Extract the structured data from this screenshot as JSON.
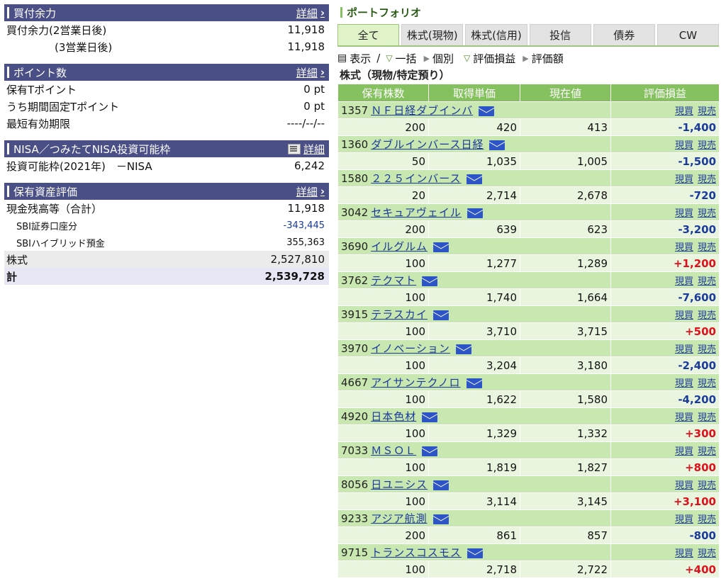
{
  "left": {
    "buying_power": {
      "title": "買付余力",
      "detail": "詳細",
      "rows": [
        {
          "label": "買付余力(2営業日後)",
          "value": "11,918"
        },
        {
          "label": "(3営業日後)",
          "value": "11,918"
        }
      ]
    },
    "points": {
      "title": "ポイント数",
      "detail": "詳細",
      "rows": [
        {
          "label": "保有Tポイント",
          "value": "0 pt"
        },
        {
          "label": "うち期間固定Tポイント",
          "value": "0 pt"
        },
        {
          "label": "最短有効期限",
          "value": "----/--/--"
        }
      ]
    },
    "nisa": {
      "title": "NISA／つみたてNISA投資可能枠",
      "detail": "詳細",
      "rows": [
        {
          "label": "投資可能枠(2021年)　－NISA",
          "value": "6,242"
        }
      ]
    },
    "assets": {
      "title": "保有資産評価",
      "detail": "詳細",
      "rows": [
        {
          "label": "現金残高等（合計）",
          "value": "11,918"
        },
        {
          "label": "SBI証券口座分",
          "value": "-343,445"
        },
        {
          "label": "SBIハイブリッド預金",
          "value": "355,363"
        },
        {
          "label": "株式",
          "value": "2,527,810"
        },
        {
          "label": "計",
          "value": "2,539,728"
        }
      ]
    }
  },
  "portfolio": {
    "title": "ポートフォリオ",
    "tabs": [
      "全て",
      "株式(現物)",
      "株式(信用)",
      "投信",
      "債券",
      "CW"
    ],
    "toolbar": {
      "display": "表示",
      "sep": "/",
      "lump": "一括",
      "individual": "個別",
      "pl": "評価損益",
      "value": "評価額"
    },
    "subtitle": "株式（現物/特定預り）",
    "headers": [
      "保有株数",
      "取得単価",
      "現在値",
      "評価損益"
    ],
    "link_buy": "現買",
    "link_sell": "現売",
    "colors": {
      "header_green": "#86c160",
      "name_row": "#c9e7b0",
      "data_row": "#eaf5df",
      "positive": "#e0101a",
      "negative": "#1a3a9c"
    },
    "stocks": [
      {
        "code": "1357",
        "name": "ＮＦ日経ダブインバ",
        "qty": "200",
        "cost": "420",
        "price": "413",
        "pl": "-1,400"
      },
      {
        "code": "1360",
        "name": "ダブルインバース日経",
        "qty": "50",
        "cost": "1,035",
        "price": "1,005",
        "pl": "-1,500"
      },
      {
        "code": "1580",
        "name": "２２５インバース",
        "qty": "20",
        "cost": "2,714",
        "price": "2,678",
        "pl": "-720"
      },
      {
        "code": "3042",
        "name": "セキュアヴェイル",
        "qty": "200",
        "cost": "639",
        "price": "623",
        "pl": "-3,200"
      },
      {
        "code": "3690",
        "name": "イルグルム",
        "qty": "100",
        "cost": "1,277",
        "price": "1,289",
        "pl": "+1,200"
      },
      {
        "code": "3762",
        "name": "テクマト",
        "qty": "100",
        "cost": "1,740",
        "price": "1,664",
        "pl": "-7,600"
      },
      {
        "code": "3915",
        "name": "テラスカイ",
        "qty": "100",
        "cost": "3,710",
        "price": "3,715",
        "pl": "+500"
      },
      {
        "code": "3970",
        "name": "イノベーション",
        "qty": "100",
        "cost": "3,204",
        "price": "3,180",
        "pl": "-2,400"
      },
      {
        "code": "4667",
        "name": "アイサンテクノロ",
        "qty": "100",
        "cost": "1,622",
        "price": "1,580",
        "pl": "-4,200"
      },
      {
        "code": "4920",
        "name": "日本色材",
        "qty": "100",
        "cost": "1,329",
        "price": "1,332",
        "pl": "+300"
      },
      {
        "code": "7033",
        "name": "ＭＳＯＬ",
        "qty": "100",
        "cost": "1,819",
        "price": "1,827",
        "pl": "+800"
      },
      {
        "code": "8056",
        "name": "日ユニシス",
        "qty": "100",
        "cost": "3,114",
        "price": "3,145",
        "pl": "+3,100"
      },
      {
        "code": "9233",
        "name": "アジア航測",
        "qty": "200",
        "cost": "861",
        "price": "857",
        "pl": "-800"
      },
      {
        "code": "9715",
        "name": "トランスコスモス",
        "qty": "100",
        "cost": "2,718",
        "price": "2,722",
        "pl": "+400"
      }
    ]
  }
}
